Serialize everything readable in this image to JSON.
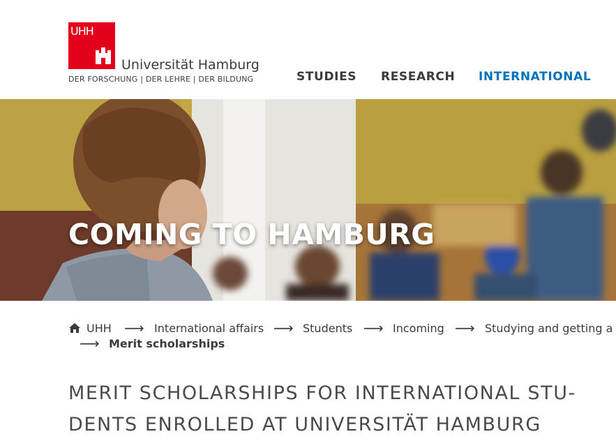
{
  "header": {
    "logo_abbr": "UHH",
    "logo_name": "Universität Hamburg",
    "logo_tagline": "DER FORSCHUNG | DER LEHRE | DER BILDUNG",
    "nav": [
      "STUDIES",
      "RESEARCH",
      "INTERNATIONAL"
    ]
  },
  "hero": {
    "title": "COMING TO HAMBURG"
  },
  "breadcrumb": {
    "items": [
      "UHH",
      "International affairs",
      "Students",
      "Incoming",
      "Studying and getting a d"
    ],
    "current": "Merit scholarships"
  },
  "page": {
    "title": "MERIT SCHOLARSHIPS FOR INTERNATIONAL STU- DENTS ENROLLED AT UNIVERSITÄT HAMBURG"
  },
  "colors": {
    "brand_red": "#e2001a",
    "accent_blue": "#0271bb"
  }
}
